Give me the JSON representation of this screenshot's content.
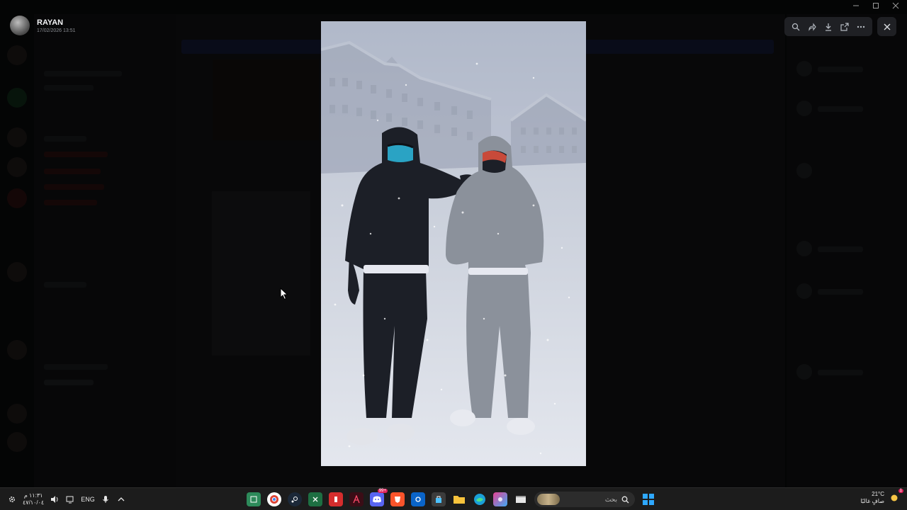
{
  "viewer": {
    "author_name": "RAYAN",
    "timestamp": "17/02/2026 13:51"
  },
  "toolbar": {
    "icons": [
      "zoom-icon",
      "forward-icon",
      "download-icon",
      "open-external-icon",
      "more-icon"
    ],
    "close_icon": "close-icon"
  },
  "taskbar": {
    "clock_time": "١١:٣١ م",
    "clock_date": "٤٧/١٠/٠٤",
    "language": "ENG",
    "search_placeholder": "بحث",
    "weather_temp": "21°C",
    "weather_desc": "صافٍ غالبًا",
    "discord_badge": "99+",
    "notification_count": "1"
  },
  "colors": {
    "accent": "#2ea8ff",
    "badge": "#e0245e",
    "taskbar_bg": "#1c1c1c"
  }
}
